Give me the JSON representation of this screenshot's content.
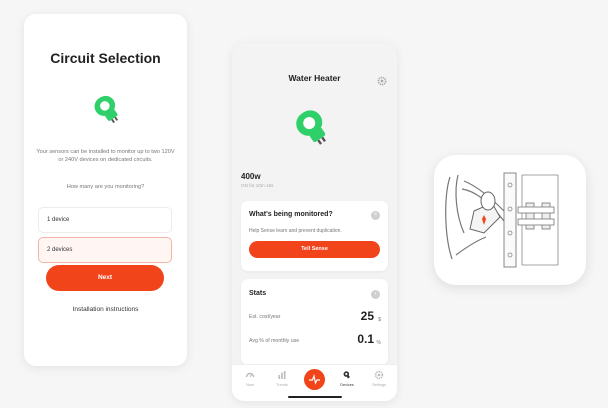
{
  "circuit_selection": {
    "title": "Circuit Selection",
    "description": "Your sensors can be installed to monitor up to two 120V or 240V devices on dedicated circuits.",
    "question": "How many are you monitoring?",
    "options": [
      "1 device",
      "2 devices"
    ],
    "selected_option": "2 devices",
    "next_label": "Next",
    "install_label": "Installation instructions"
  },
  "device": {
    "title": "Water Heater",
    "watts": "400w",
    "watts_sub": "ON for 10m 15s",
    "monitored_title": "What's being monitored?",
    "monitored_sub": "Help Sense learn and prevent duplication.",
    "tell_label": "Tell Sense",
    "stats_title": "Stats",
    "stat1_label": "Est. cost/year",
    "stat1_value": "25",
    "stat1_unit": "$",
    "stat2_label": "Avg % of monthly use",
    "stat2_value": "0.1",
    "stat2_unit": "%",
    "tabs": [
      "Now",
      "Trends",
      "Devices",
      "Settings"
    ],
    "active_tab": "Devices"
  },
  "colors": {
    "accent": "#f2441b",
    "plug_green": "#2fcf6a"
  },
  "icons": [
    "plug-icon",
    "gear-icon",
    "close-icon",
    "chevron-right-icon",
    "pulse-icon",
    "sensor-clamp-illustration"
  ]
}
